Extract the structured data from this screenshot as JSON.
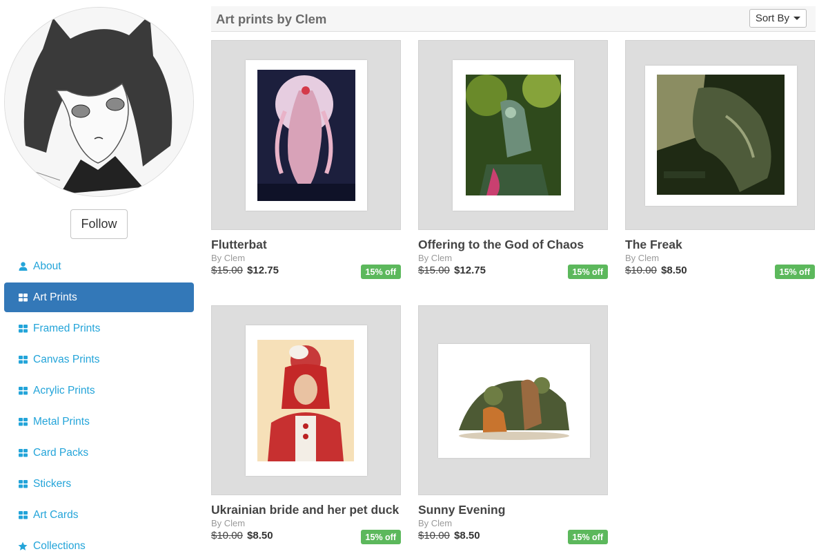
{
  "sidebar": {
    "follow_label": "Follow",
    "items": [
      {
        "label": "About",
        "icon": "user-icon"
      },
      {
        "label": "Art Prints",
        "icon": "grid-icon",
        "active": true
      },
      {
        "label": "Framed Prints",
        "icon": "grid-icon"
      },
      {
        "label": "Canvas Prints",
        "icon": "grid-icon"
      },
      {
        "label": "Acrylic Prints",
        "icon": "grid-icon"
      },
      {
        "label": "Metal Prints",
        "icon": "grid-icon"
      },
      {
        "label": "Card Packs",
        "icon": "grid-icon"
      },
      {
        "label": "Stickers",
        "icon": "grid-icon"
      },
      {
        "label": "Art Cards",
        "icon": "grid-icon"
      },
      {
        "label": "Collections",
        "icon": "star-icon"
      }
    ]
  },
  "header": {
    "title": "Art prints by Clem",
    "sort_label": "Sort By"
  },
  "products": [
    {
      "title": "Flutterbat",
      "by": "By Clem",
      "old_price": "$15.00",
      "new_price": "$12.75",
      "badge": "15% off"
    },
    {
      "title": "Offering to the God of Chaos",
      "by": "By Clem",
      "old_price": "$15.00",
      "new_price": "$12.75",
      "badge": "15% off"
    },
    {
      "title": "The Freak",
      "by": "By Clem",
      "old_price": "$10.00",
      "new_price": "$8.50",
      "badge": "15% off"
    },
    {
      "title": "Ukrainian bride and her pet duck",
      "by": "By Clem",
      "old_price": "$10.00",
      "new_price": "$8.50",
      "badge": "15% off"
    },
    {
      "title": "Sunny Evening",
      "by": "By Clem",
      "old_price": "$10.00",
      "new_price": "$8.50",
      "badge": "15% off"
    }
  ],
  "colors": {
    "accent": "#23a4d9",
    "active_bg": "#3378b8",
    "badge_green": "#5cb85c"
  }
}
